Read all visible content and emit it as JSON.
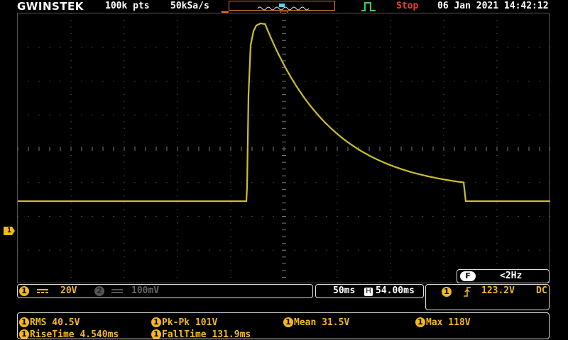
{
  "topbar": {
    "logo": "GWINSTEK",
    "record_length": "100k pts",
    "sample_rate": "50kSa/s",
    "run_state": "Stop",
    "datetime": "06 Jan 2021 14:42:12"
  },
  "channel_marker": "1",
  "vertical": {
    "ch1_scale": "20V",
    "ch2_label": "2",
    "ch2_scale": "100mV"
  },
  "horizontal": {
    "timebase": "50ms",
    "position_icon": "H",
    "position": "54.00ms"
  },
  "trigger": {
    "source": "1",
    "slope_icon": "rising-edge-icon",
    "level": "123.2V",
    "coupling": "DC"
  },
  "frequency": {
    "label": "F",
    "value": "<2Hz"
  },
  "measurements": [
    {
      "channel": "1",
      "text": "RMS 40.5V"
    },
    {
      "channel": "1",
      "text": "Pk-Pk 101V"
    },
    {
      "channel": "1",
      "text": "Mean 31.5V"
    },
    {
      "channel": "1",
      "text": "Max 118V"
    },
    {
      "channel": "1",
      "text": "RiseTime 4.540ms"
    },
    {
      "channel": "1",
      "text": "FallTime 131.9ms"
    }
  ],
  "colors": {
    "ch1": "#f3b81f",
    "trace": "#c8c02a",
    "stop": "#ff3b2f",
    "memory_bar": "#e0762a",
    "trigger_icon": "#3fd24a"
  }
}
